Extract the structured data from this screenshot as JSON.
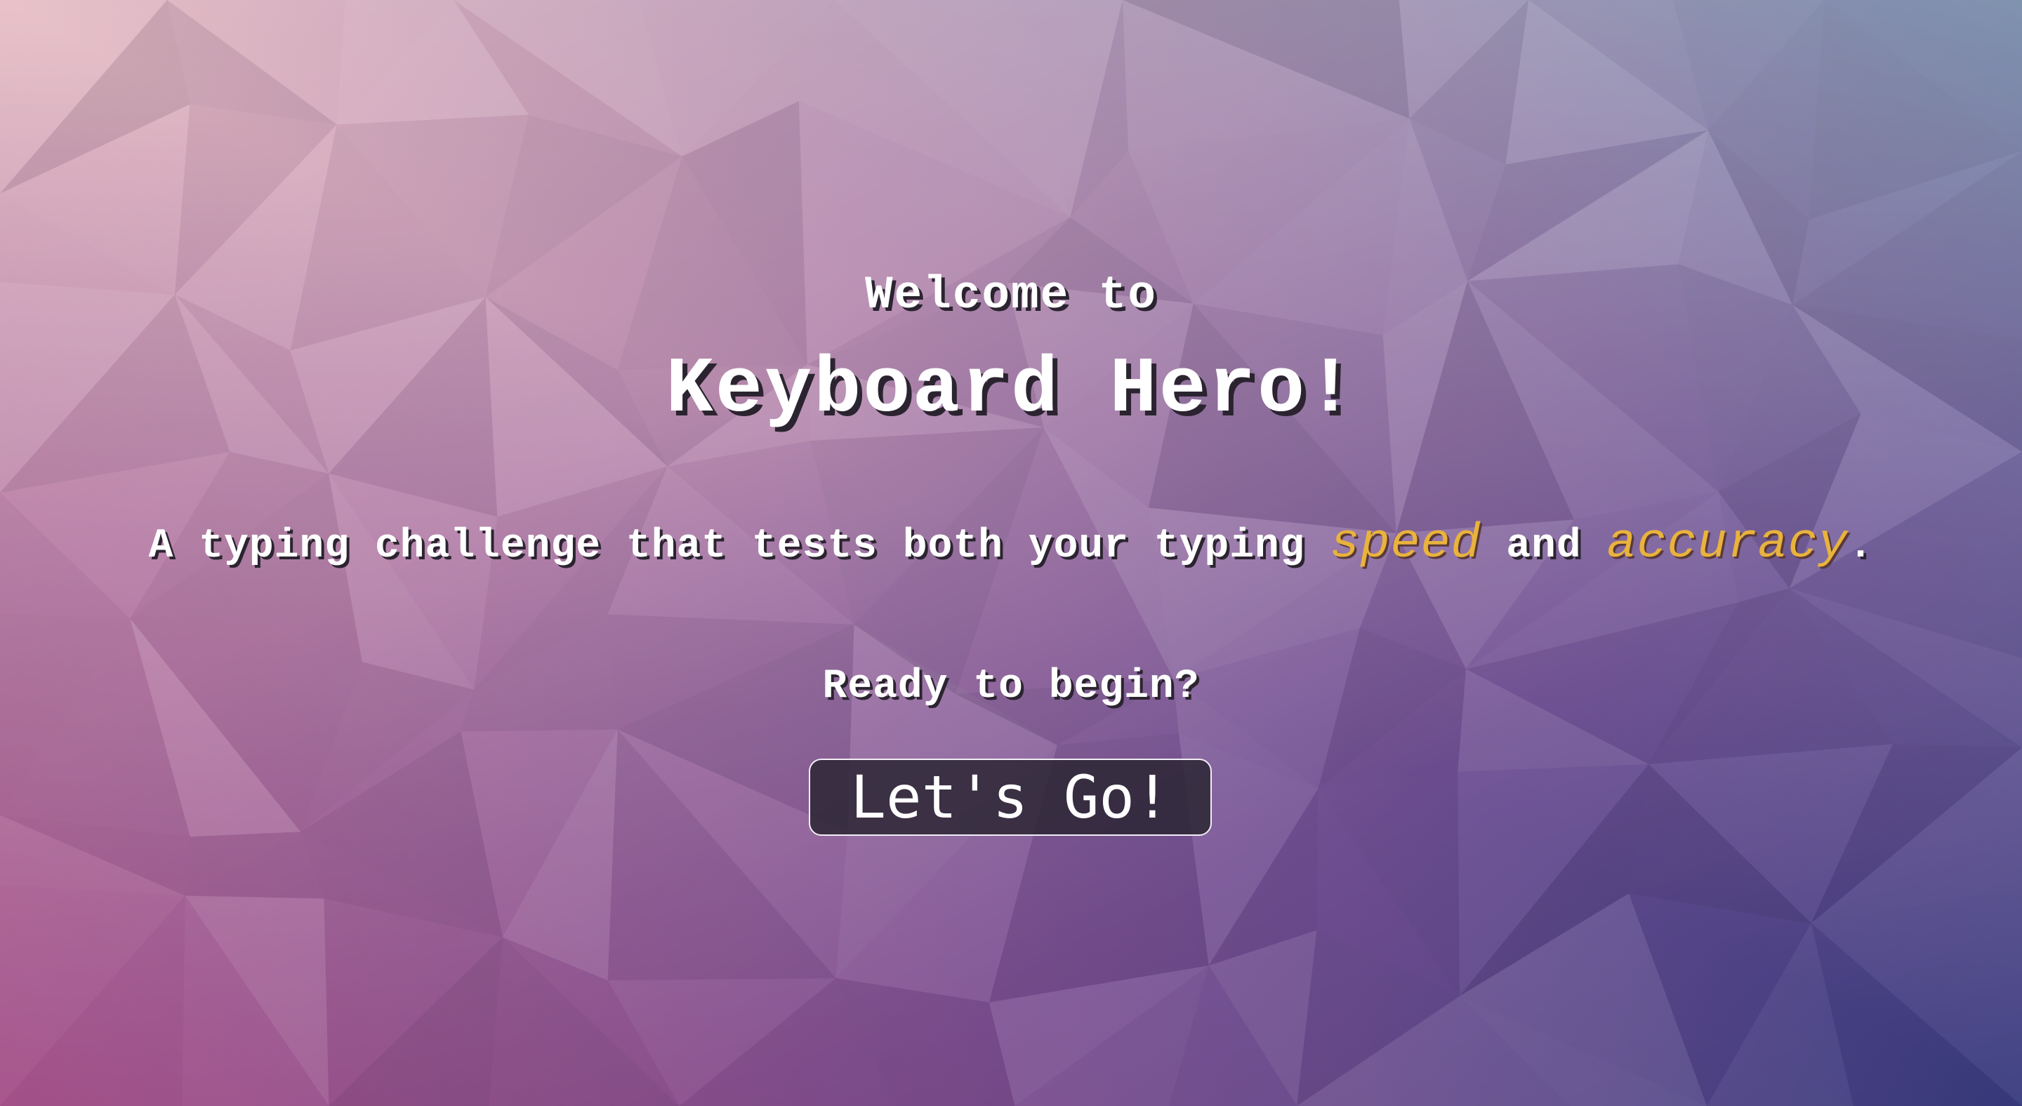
{
  "welcome": {
    "line1": "Welcome to",
    "title": "Keyboard Hero!"
  },
  "tagline": {
    "prefix": "A typing challenge that tests both your typing ",
    "word_speed": "speed",
    "middle": " and ",
    "word_accuracy": "accuracy",
    "suffix": "."
  },
  "prompt": "Ready to begin?",
  "start_button": {
    "label": "Let's Go!"
  },
  "colors": {
    "highlight": "#e9b33c",
    "text": "#ffffff",
    "button_bg": "#2c2634"
  }
}
